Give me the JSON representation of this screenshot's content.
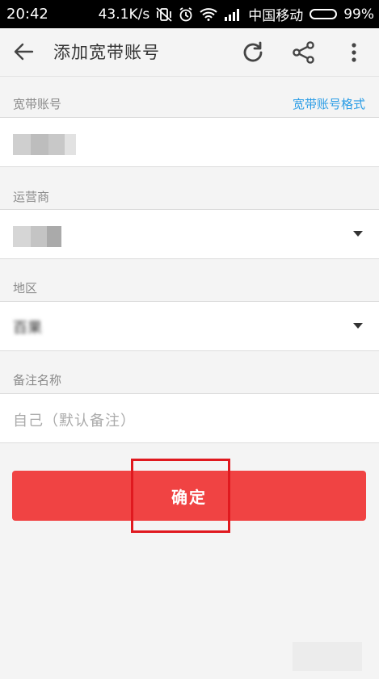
{
  "status_bar": {
    "time": "20:42",
    "speed": "43.1K/s",
    "carrier": "中国移动",
    "battery": "99%",
    "battery_level": 0.99
  },
  "app_bar": {
    "title": "添加宽带账号",
    "back_icon": "arrow-left-icon",
    "refresh_icon": "refresh-icon",
    "share_icon": "share-icon",
    "more_icon": "more-vertical-icon"
  },
  "form": {
    "account": {
      "label": "宽带账号",
      "help_link": "宽带账号格式"
    },
    "operator": {
      "label": "运营商"
    },
    "region": {
      "label": "地区",
      "value": "百果"
    },
    "remark": {
      "label": "备注名称",
      "placeholder": "自己（默认备注）"
    }
  },
  "confirm_button": {
    "label": "确定"
  },
  "colors": {
    "accent": "#f04343",
    "link": "#2b9de6",
    "highlight_box": "#e0191f",
    "background": "#f4f4f4"
  }
}
